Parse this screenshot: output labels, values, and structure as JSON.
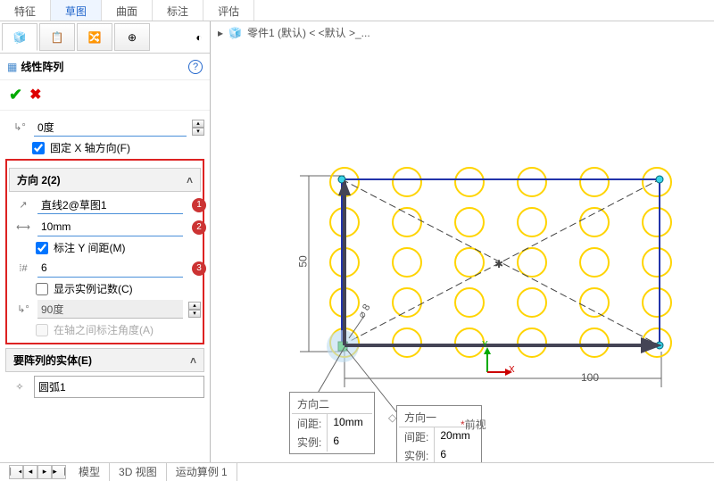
{
  "top_tabs": [
    "特征",
    "草图",
    "曲面",
    "标注",
    "评估"
  ],
  "top_active": 1,
  "viewport_icons": [
    "zoom-fit-icon",
    "zoom-icon",
    "brush-icon",
    "section-icon",
    "appearance-icon",
    "view-orientation-icon"
  ],
  "left_tabs_icons": [
    "feature-tree-icon",
    "property-icon",
    "config-icon",
    "dimxpert-icon"
  ],
  "pm": {
    "icon": "linear-pattern-icon",
    "title": "线性阵列",
    "angle_x": {
      "value": "0度"
    },
    "fix_x_label": "固定 X 轴方向(F)",
    "dir2": {
      "header": "方向 2(2)",
      "ref": "直线2@草图1",
      "spacing": "10mm",
      "dim_y_label": "标注 Y 间距(M)",
      "count": "6",
      "show_count_label": "显示实例记数(C)",
      "angle2": "90度",
      "angle_between_label": "在轴之间标注角度(A)"
    },
    "entities": {
      "header": "要阵列的实体(E)",
      "item": "圆弧1"
    },
    "badges": {
      "b1": "1",
      "b2": "2",
      "b3": "3"
    }
  },
  "breadcrumb": {
    "part": "零件1 (默认) < <默认 >_..."
  },
  "dims": {
    "height": "50",
    "width": "100",
    "diam": "⌀ 8"
  },
  "callout1": {
    "title": "方向二",
    "spacing_label": "间距:",
    "spacing": "10mm",
    "count_label": "实例:",
    "count": "6"
  },
  "callout2": {
    "title": "方向一",
    "spacing_label": "间距:",
    "spacing": "20mm",
    "count_label": "实例:",
    "count": "6"
  },
  "axes": {
    "x": "X",
    "y": "Y"
  },
  "front_view": "前视",
  "bottom_tabs": [
    "模型",
    "3D 视图",
    "运动算例 1"
  ]
}
